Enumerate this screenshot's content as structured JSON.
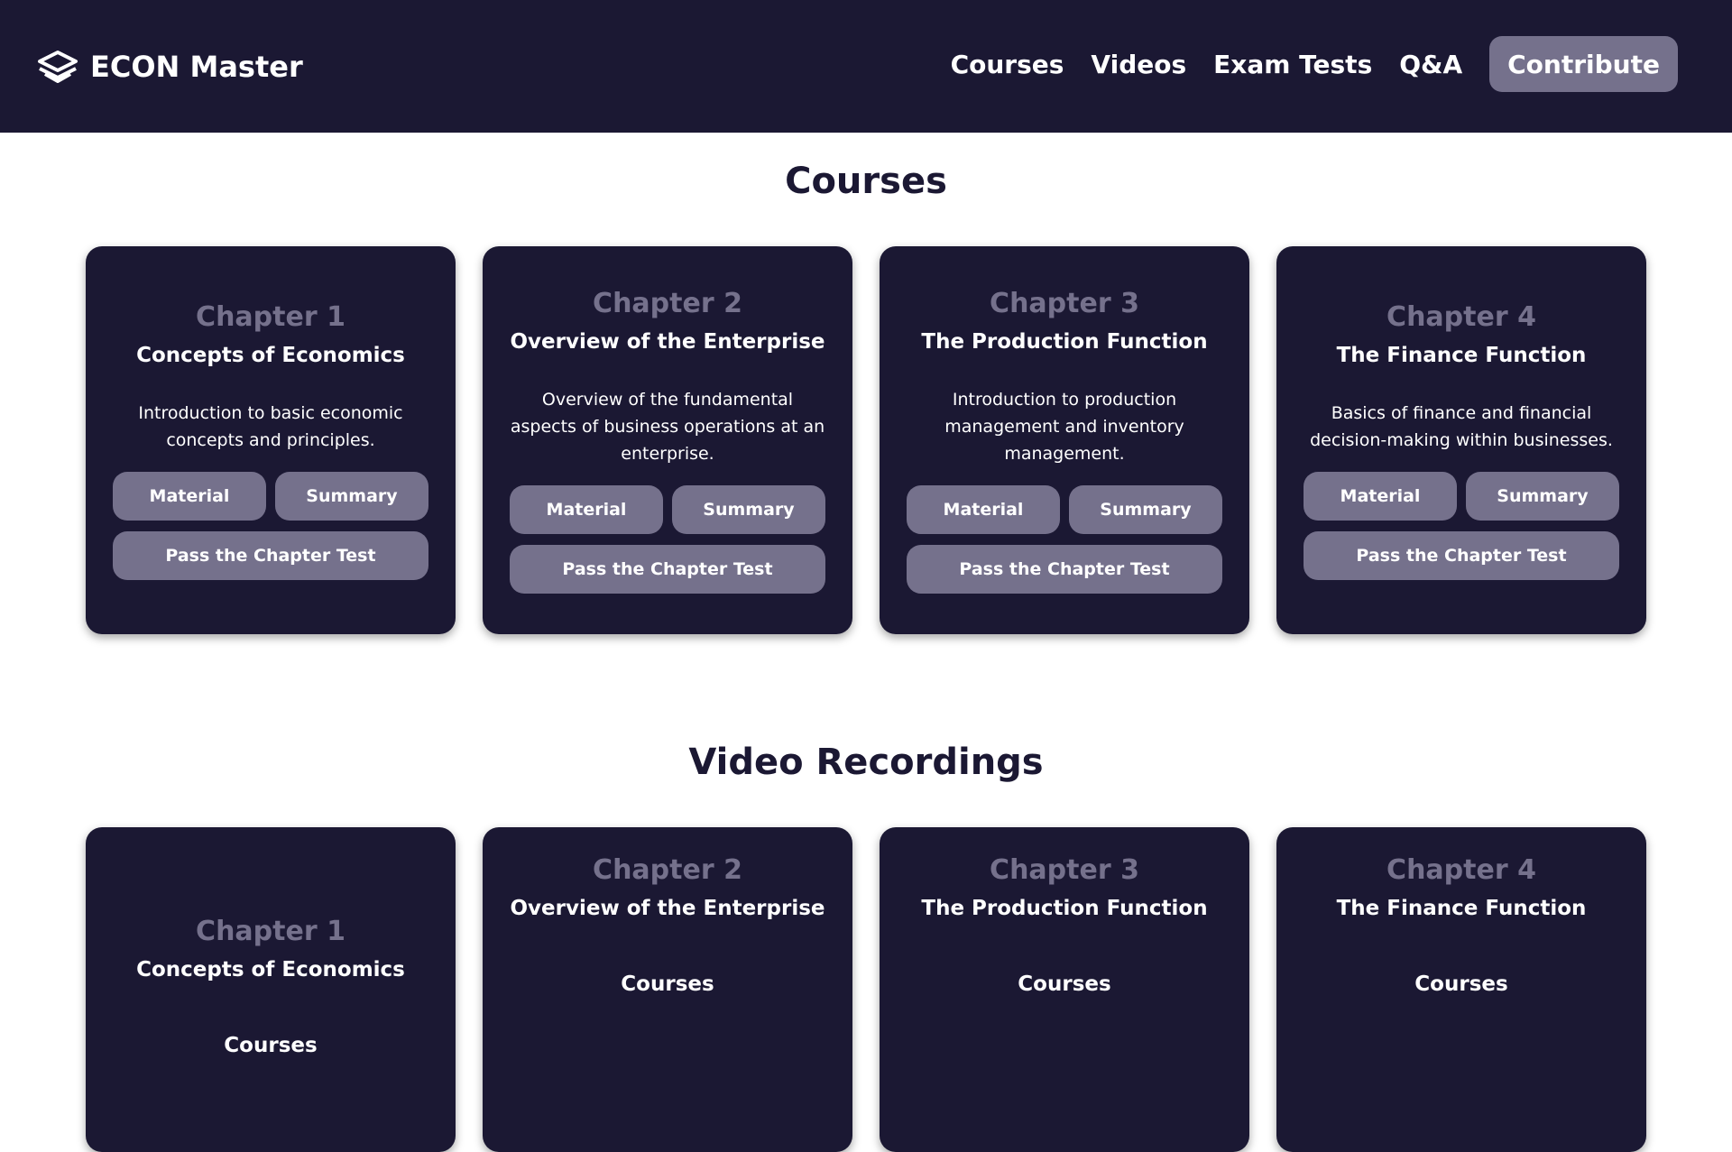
{
  "nav": {
    "brand": "ECON Master",
    "links": [
      "Courses",
      "Videos",
      "Exam Tests",
      "Q&A"
    ],
    "cta": "Contribute"
  },
  "courses": {
    "title": "Courses",
    "cards": [
      {
        "chapter": "Chapter 1",
        "name": "Concepts of Economics",
        "desc": "Introduction to basic economic concepts and principles.",
        "material": "Material",
        "summary": "Summary",
        "test": "Pass the Chapter Test"
      },
      {
        "chapter": "Chapter 2",
        "name": "Overview of the Enterprise",
        "desc": "Overview of the fundamental aspects of business operations at an enterprise.",
        "material": "Material",
        "summary": "Summary",
        "test": "Pass the Chapter Test"
      },
      {
        "chapter": "Chapter 3",
        "name": "The Production Function",
        "desc": "Introduction to production management and inventory management.",
        "material": "Material",
        "summary": "Summary",
        "test": "Pass the Chapter Test"
      },
      {
        "chapter": "Chapter 4",
        "name": "The Finance Function",
        "desc": "Basics of finance and financial decision-making within businesses.",
        "material": "Material",
        "summary": "Summary",
        "test": "Pass the Chapter Test"
      }
    ]
  },
  "videos": {
    "title": "Video Recordings",
    "cards": [
      {
        "chapter": "Chapter 1",
        "name": "Concepts of Economics",
        "sub": "Courses"
      },
      {
        "chapter": "Chapter 2",
        "name": "Overview of the Enterprise",
        "sub": "Courses"
      },
      {
        "chapter": "Chapter 3",
        "name": "The Production Function",
        "sub": "Courses"
      },
      {
        "chapter": "Chapter 4",
        "name": "The Finance Function",
        "sub": "Courses"
      }
    ]
  },
  "colors": {
    "nav_bg": "#1b1833",
    "card_bg": "#1b1833",
    "button_bg": "#75718c",
    "accent_text": "#75718c"
  },
  "icons": {
    "logo": "stacked-layers-icon"
  }
}
